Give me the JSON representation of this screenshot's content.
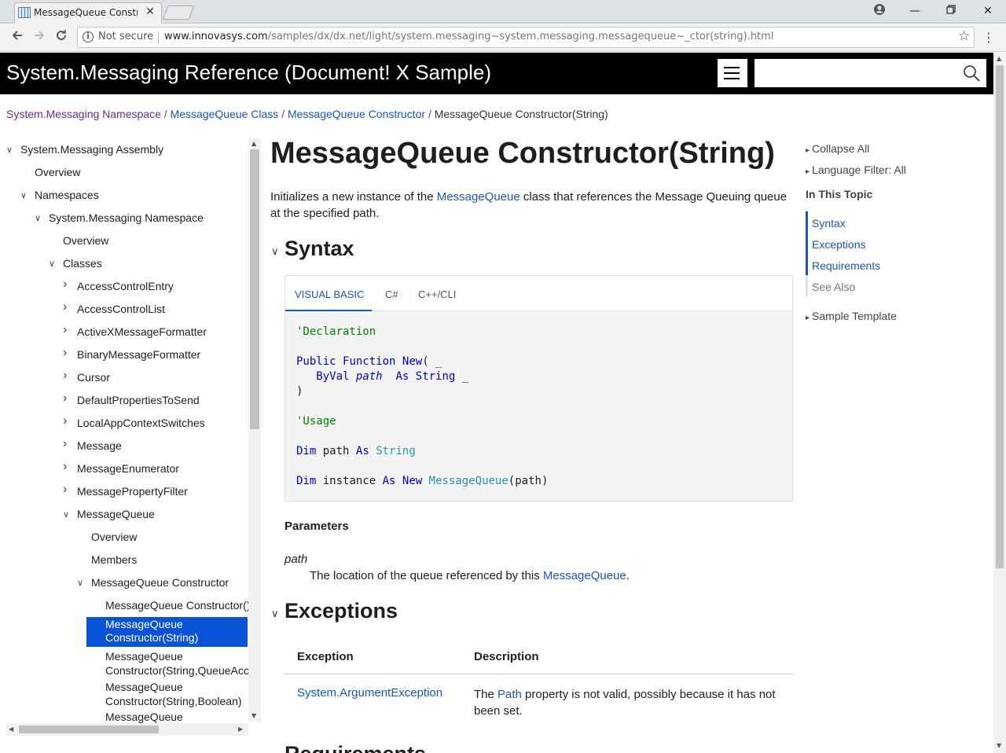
{
  "browser": {
    "tab_title": "MessageQueue Constructor(String)",
    "security": "Not secure",
    "url_host": "www.innovasys.com",
    "url_path": "/samples/dx/dx.net/light/system.messaging~system.messaging.messagequeue~_ctor(string).html"
  },
  "header": {
    "site_title": "System.Messaging Reference (Document! X Sample)",
    "search_placeholder": ""
  },
  "breadcrumb": {
    "items": [
      "System.Messaging Namespace",
      "MessageQueue Class",
      "MessageQueue Constructor"
    ],
    "current": "MessageQueue Constructor(String)",
    "separator": "/"
  },
  "toc": {
    "items": [
      {
        "label": "System.Messaging Assembly",
        "expanded": true
      },
      {
        "label": "Overview"
      },
      {
        "label": "Namespaces",
        "expanded": true
      },
      {
        "label": "System.Messaging Namespace",
        "expanded": true
      },
      {
        "label": "Overview"
      },
      {
        "label": "Classes",
        "expanded": true
      },
      {
        "label": "AccessControlEntry",
        "expanded": false
      },
      {
        "label": "AccessControlList",
        "expanded": false
      },
      {
        "label": "ActiveXMessageFormatter",
        "expanded": false
      },
      {
        "label": "BinaryMessageFormatter",
        "expanded": false
      },
      {
        "label": "Cursor",
        "expanded": false
      },
      {
        "label": "DefaultPropertiesToSend",
        "expanded": false
      },
      {
        "label": "LocalAppContextSwitches",
        "expanded": false
      },
      {
        "label": "Message",
        "expanded": false
      },
      {
        "label": "MessageEnumerator",
        "expanded": false
      },
      {
        "label": "MessagePropertyFilter",
        "expanded": false
      },
      {
        "label": "MessageQueue",
        "expanded": true
      },
      {
        "label": "Overview"
      },
      {
        "label": "Members"
      },
      {
        "label": "MessageQueue Constructor",
        "expanded": true
      },
      {
        "label": "MessageQueue Constructor()"
      },
      {
        "label": "MessageQueue Constructor(String)",
        "line1": "MessageQueue",
        "line2": "Constructor(String)",
        "selected": true
      },
      {
        "label": "MessageQueue Constructor(String,QueueAcc",
        "line1": "MessageQueue",
        "line2": "Constructor(String,QueueAcc"
      },
      {
        "label": "MessageQueue Constructor(String,Boolean)",
        "line1": "MessageQueue",
        "line2": "Constructor(String,Boolean)"
      },
      {
        "label": "MessageQueue",
        "line1": "MessageQueue"
      }
    ]
  },
  "main": {
    "title": "MessageQueue Constructor(String)",
    "intro_before": "Initializes a new instance of the ",
    "intro_link": "MessageQueue",
    "intro_after": " class that references the Message Queuing queue at the specified path.",
    "syntax_heading": "Syntax",
    "code_tabs": [
      "VISUAL BASIC",
      "C#",
      "C++/CLI"
    ],
    "active_code_tab": "VISUAL BASIC",
    "code": {
      "declaration_comment": "'Declaration",
      "kw_public": "Public",
      "kw_function": "Function",
      "kw_new": "New",
      "paren_open": "( _",
      "kw_byval": "ByVal",
      "param": "path",
      "kw_as": "As",
      "type_string": "String",
      "line_cont": " _",
      "paren_close": ")",
      "usage_comment": "'Usage",
      "kw_dim": "Dim",
      "var_path": "path",
      "var_instance": "instance",
      "type_mq": "MessageQueue",
      "call_arg": "(path)"
    },
    "params_heading": "Parameters",
    "param_name": "path",
    "param_desc_before": "The location of the queue referenced by this ",
    "param_desc_link": "MessageQueue",
    "param_desc_after": ".",
    "exceptions_heading": "Exceptions",
    "exceptions_columns": [
      "Exception",
      "Description"
    ],
    "exceptions_rows": [
      {
        "exception": "System.ArgumentException",
        "desc_before": "The ",
        "desc_link": "Path",
        "desc_after": " property is not valid, possibly because it has not been set."
      }
    ],
    "next_heading_partial": "Requirements"
  },
  "side": {
    "collapse_all": "Collapse All",
    "language_filter": "Language Filter: All",
    "in_this_topic": "In This Topic",
    "topic_links": [
      "Syntax",
      "Exceptions",
      "Requirements",
      "See Also"
    ],
    "sample_template": "Sample Template"
  },
  "colors": {
    "link": "#1a55b8",
    "visited": "#6a2a8c",
    "selection": "#0b53d6",
    "header_bg": "#000000"
  }
}
